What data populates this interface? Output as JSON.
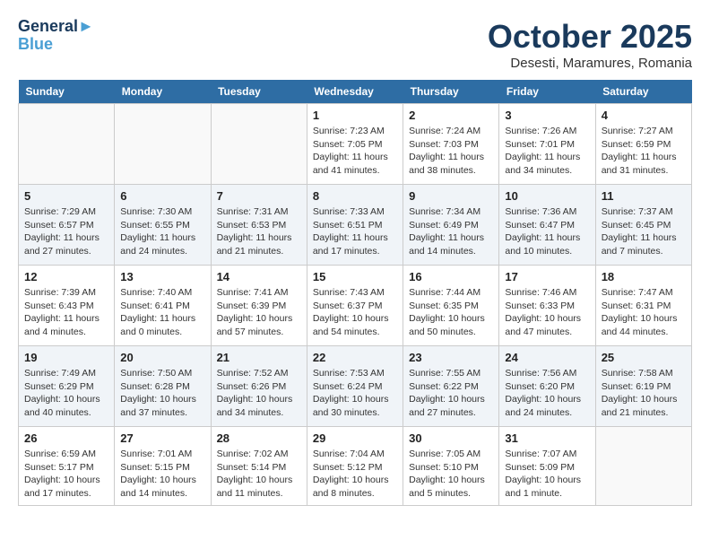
{
  "logo": {
    "line1": "General",
    "line2": "Blue"
  },
  "title": "October 2025",
  "location": "Desesti, Maramures, Romania",
  "days_of_week": [
    "Sunday",
    "Monday",
    "Tuesday",
    "Wednesday",
    "Thursday",
    "Friday",
    "Saturday"
  ],
  "weeks": [
    [
      {
        "day": "",
        "info": ""
      },
      {
        "day": "",
        "info": ""
      },
      {
        "day": "",
        "info": ""
      },
      {
        "day": "1",
        "info": "Sunrise: 7:23 AM\nSunset: 7:05 PM\nDaylight: 11 hours and 41 minutes."
      },
      {
        "day": "2",
        "info": "Sunrise: 7:24 AM\nSunset: 7:03 PM\nDaylight: 11 hours and 38 minutes."
      },
      {
        "day": "3",
        "info": "Sunrise: 7:26 AM\nSunset: 7:01 PM\nDaylight: 11 hours and 34 minutes."
      },
      {
        "day": "4",
        "info": "Sunrise: 7:27 AM\nSunset: 6:59 PM\nDaylight: 11 hours and 31 minutes."
      }
    ],
    [
      {
        "day": "5",
        "info": "Sunrise: 7:29 AM\nSunset: 6:57 PM\nDaylight: 11 hours and 27 minutes."
      },
      {
        "day": "6",
        "info": "Sunrise: 7:30 AM\nSunset: 6:55 PM\nDaylight: 11 hours and 24 minutes."
      },
      {
        "day": "7",
        "info": "Sunrise: 7:31 AM\nSunset: 6:53 PM\nDaylight: 11 hours and 21 minutes."
      },
      {
        "day": "8",
        "info": "Sunrise: 7:33 AM\nSunset: 6:51 PM\nDaylight: 11 hours and 17 minutes."
      },
      {
        "day": "9",
        "info": "Sunrise: 7:34 AM\nSunset: 6:49 PM\nDaylight: 11 hours and 14 minutes."
      },
      {
        "day": "10",
        "info": "Sunrise: 7:36 AM\nSunset: 6:47 PM\nDaylight: 11 hours and 10 minutes."
      },
      {
        "day": "11",
        "info": "Sunrise: 7:37 AM\nSunset: 6:45 PM\nDaylight: 11 hours and 7 minutes."
      }
    ],
    [
      {
        "day": "12",
        "info": "Sunrise: 7:39 AM\nSunset: 6:43 PM\nDaylight: 11 hours and 4 minutes."
      },
      {
        "day": "13",
        "info": "Sunrise: 7:40 AM\nSunset: 6:41 PM\nDaylight: 11 hours and 0 minutes."
      },
      {
        "day": "14",
        "info": "Sunrise: 7:41 AM\nSunset: 6:39 PM\nDaylight: 10 hours and 57 minutes."
      },
      {
        "day": "15",
        "info": "Sunrise: 7:43 AM\nSunset: 6:37 PM\nDaylight: 10 hours and 54 minutes."
      },
      {
        "day": "16",
        "info": "Sunrise: 7:44 AM\nSunset: 6:35 PM\nDaylight: 10 hours and 50 minutes."
      },
      {
        "day": "17",
        "info": "Sunrise: 7:46 AM\nSunset: 6:33 PM\nDaylight: 10 hours and 47 minutes."
      },
      {
        "day": "18",
        "info": "Sunrise: 7:47 AM\nSunset: 6:31 PM\nDaylight: 10 hours and 44 minutes."
      }
    ],
    [
      {
        "day": "19",
        "info": "Sunrise: 7:49 AM\nSunset: 6:29 PM\nDaylight: 10 hours and 40 minutes."
      },
      {
        "day": "20",
        "info": "Sunrise: 7:50 AM\nSunset: 6:28 PM\nDaylight: 10 hours and 37 minutes."
      },
      {
        "day": "21",
        "info": "Sunrise: 7:52 AM\nSunset: 6:26 PM\nDaylight: 10 hours and 34 minutes."
      },
      {
        "day": "22",
        "info": "Sunrise: 7:53 AM\nSunset: 6:24 PM\nDaylight: 10 hours and 30 minutes."
      },
      {
        "day": "23",
        "info": "Sunrise: 7:55 AM\nSunset: 6:22 PM\nDaylight: 10 hours and 27 minutes."
      },
      {
        "day": "24",
        "info": "Sunrise: 7:56 AM\nSunset: 6:20 PM\nDaylight: 10 hours and 24 minutes."
      },
      {
        "day": "25",
        "info": "Sunrise: 7:58 AM\nSunset: 6:19 PM\nDaylight: 10 hours and 21 minutes."
      }
    ],
    [
      {
        "day": "26",
        "info": "Sunrise: 6:59 AM\nSunset: 5:17 PM\nDaylight: 10 hours and 17 minutes."
      },
      {
        "day": "27",
        "info": "Sunrise: 7:01 AM\nSunset: 5:15 PM\nDaylight: 10 hours and 14 minutes."
      },
      {
        "day": "28",
        "info": "Sunrise: 7:02 AM\nSunset: 5:14 PM\nDaylight: 10 hours and 11 minutes."
      },
      {
        "day": "29",
        "info": "Sunrise: 7:04 AM\nSunset: 5:12 PM\nDaylight: 10 hours and 8 minutes."
      },
      {
        "day": "30",
        "info": "Sunrise: 7:05 AM\nSunset: 5:10 PM\nDaylight: 10 hours and 5 minutes."
      },
      {
        "day": "31",
        "info": "Sunrise: 7:07 AM\nSunset: 5:09 PM\nDaylight: 10 hours and 1 minute."
      },
      {
        "day": "",
        "info": ""
      }
    ]
  ]
}
